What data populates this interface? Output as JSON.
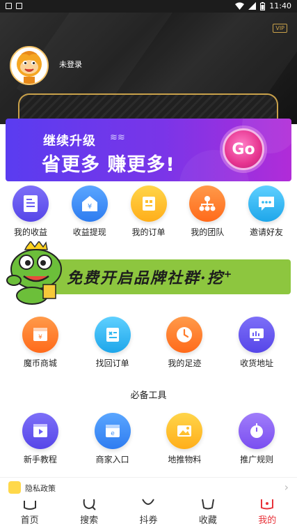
{
  "status_bar": {
    "time": "11:40"
  },
  "header": {
    "vip_badge": "VIP",
    "username": "未登录"
  },
  "promo": {
    "line1": "继续升级",
    "line2": "省更多 赚更多!",
    "button": "Go"
  },
  "income_menu": [
    {
      "label": "我的收益",
      "icon": "income-report-icon",
      "color": "#6a5cf5"
    },
    {
      "label": "收益提现",
      "icon": "withdraw-icon",
      "color": "#3d8ef5"
    },
    {
      "label": "我的订单",
      "icon": "order-list-icon",
      "color": "#ffbf2e"
    },
    {
      "label": "我的团队",
      "icon": "team-tree-icon",
      "color": "#ff7b2b"
    },
    {
      "label": "邀请好友",
      "icon": "chat-bubble-icon",
      "color": "#2fb6f0"
    }
  ],
  "frog_banner": {
    "text": "免费开启品牌社群·挖",
    "sup": "+"
  },
  "service_menu": [
    {
      "label": "魔币商城",
      "icon": "coin-mall-icon",
      "color": "#ff7b2b"
    },
    {
      "label": "找回订单",
      "icon": "retrieve-order-icon",
      "color": "#2fb6f0"
    },
    {
      "label": "我的足迹",
      "icon": "clock-icon",
      "color": "#ff7b2b"
    },
    {
      "label": "收货地址",
      "icon": "address-screen-icon",
      "color": "#6a5cf5"
    }
  ],
  "tools": {
    "title": "必备工具",
    "items": [
      {
        "label": "新手教程",
        "icon": "video-tutorial-icon",
        "color": "#6a5cf5"
      },
      {
        "label": "商家入口",
        "icon": "merchant-entry-icon",
        "color": "#3d8ef5"
      },
      {
        "label": "地推物料",
        "icon": "image-material-icon",
        "color": "#ffbf2e"
      },
      {
        "label": "推广规则",
        "icon": "rules-knob-icon",
        "color": "#8a5cf5"
      }
    ]
  },
  "privacy": {
    "label": "隐私政策"
  },
  "tabs": [
    {
      "label": "首页",
      "active": false
    },
    {
      "label": "搜索",
      "active": false
    },
    {
      "label": "抖券",
      "active": false
    },
    {
      "label": "收藏",
      "active": false
    },
    {
      "label": "我的",
      "active": true
    }
  ],
  "colors": {
    "active_tab": "#e8333a",
    "gold": "#c9a14a",
    "promo_purple": "#6a3cf0",
    "frog_green": "#8dc63f"
  }
}
